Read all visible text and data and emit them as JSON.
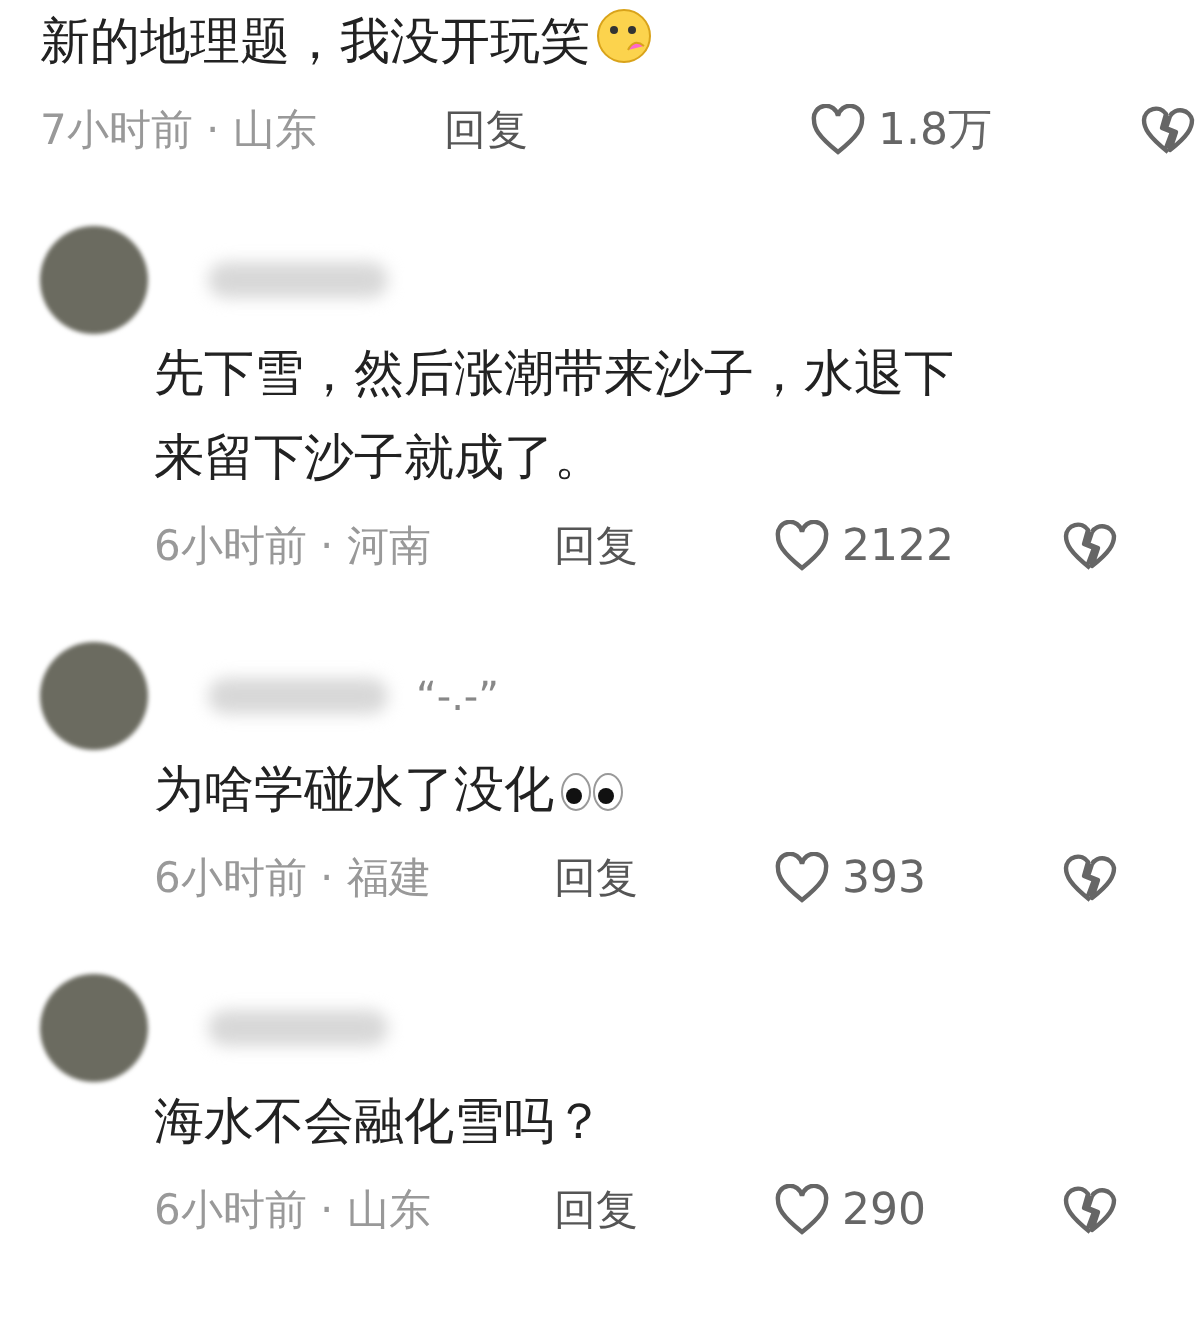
{
  "comments": [
    {
      "kind": "cut",
      "text": "新的地理题，我没开玩笑",
      "face_icon": true,
      "meta": "7小时前 · 山东",
      "reply": "回复",
      "likes": "1.8万"
    },
    {
      "kind": "full",
      "text": "先下雪，然后涨潮带来沙子，水退下来留下沙子就成了。",
      "meta": "6小时前 · 河南",
      "reply": "回复",
      "likes": "2122"
    },
    {
      "kind": "full",
      "name": "“-.-”",
      "text": "为啥学碰水了没化",
      "eyes_icon": true,
      "meta": "6小时前 · 福建",
      "reply": "回复",
      "likes": "393"
    },
    {
      "kind": "full",
      "text": "海水不会融化雪吗？",
      "meta": "6小时前 · 山东",
      "reply": "回复",
      "likes": "290"
    }
  ]
}
